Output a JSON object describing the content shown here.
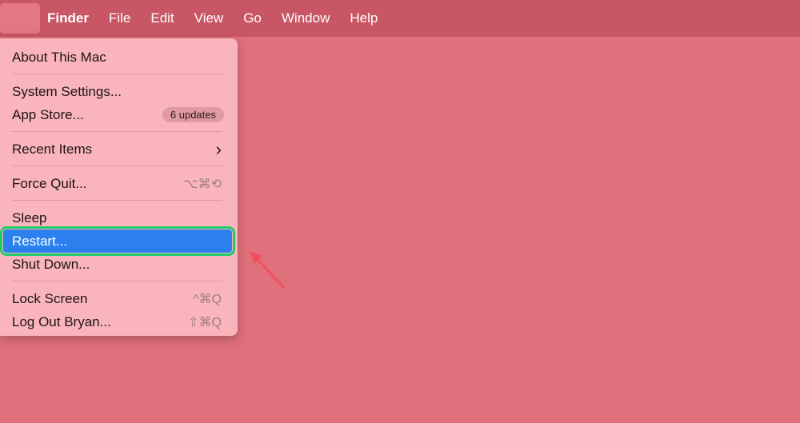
{
  "menubar": {
    "apple": "",
    "items": [
      "Finder",
      "File",
      "Edit",
      "View",
      "Go",
      "Window",
      "Help"
    ]
  },
  "menu": {
    "about": "About This Mac",
    "settings": "System Settings...",
    "appstore": "App Store...",
    "updates": "6 updates",
    "recent": "Recent Items",
    "recent_chevron": "›",
    "forcequit": "Force Quit...",
    "forcequit_sc": "⌥⌘⟲",
    "sleep": "Sleep",
    "restart": "Restart...",
    "shutdown": "Shut Down...",
    "lock": "Lock Screen",
    "lock_sc": "^⌘Q",
    "logout": "Log Out Bryan...",
    "logout_sc": "⇧⌘Q"
  },
  "colors": {
    "highlight": "#2b80ee",
    "annotation_box": "#1fcc6a",
    "arrow": "#f0505e"
  }
}
